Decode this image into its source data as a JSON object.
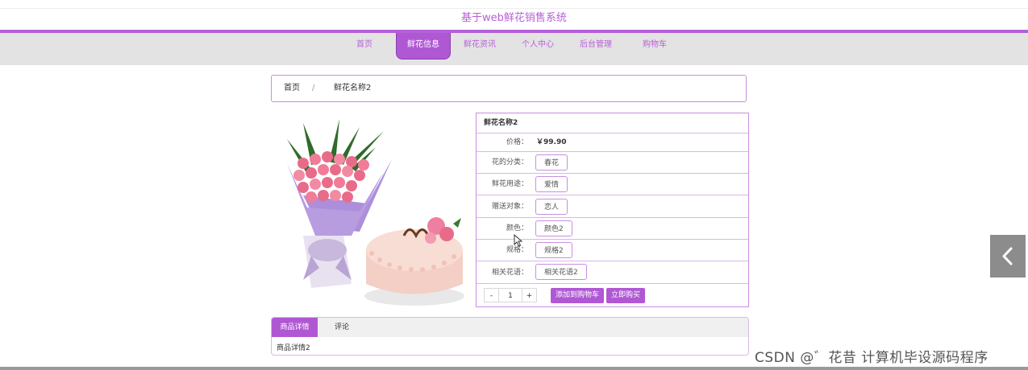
{
  "site": {
    "title": "基于web鲜花销售系统"
  },
  "nav": {
    "items": [
      {
        "label": "首页"
      },
      {
        "label": "鲜花信息"
      },
      {
        "label": "鲜花资讯"
      },
      {
        "label": "个人中心"
      },
      {
        "label": "后台管理"
      },
      {
        "label": "购物车"
      }
    ],
    "active_index": 1
  },
  "breadcrumb": {
    "home": "首页",
    "separator": "/",
    "current": "鲜花名称2"
  },
  "product": {
    "name": "鲜花名称2",
    "price_label": "价格：",
    "price": "￥99.90",
    "fields": [
      {
        "label": "花的分类：",
        "value": "春花"
      },
      {
        "label": "鲜花用途：",
        "value": "爱情"
      },
      {
        "label": "赠送对象：",
        "value": "恋人"
      },
      {
        "label": "颜色：",
        "value": "颜色2"
      },
      {
        "label": "规格：",
        "value": "规格2"
      },
      {
        "label": "相关花语：",
        "value": "相关花语2"
      }
    ],
    "quantity": {
      "minus": "-",
      "value": "1",
      "plus": "+"
    },
    "add_to_cart": "添加到购物车",
    "buy_now": "立即购买"
  },
  "tabs": {
    "items": [
      {
        "label": "商品详情"
      },
      {
        "label": "评论"
      }
    ],
    "active_index": 0,
    "content": "商品详情2"
  },
  "watermark": "CSDN @゛花昔 计算机毕设源码程序",
  "colors": {
    "accent": "#b058d4",
    "nav_bg": "#e3e3e4",
    "border": "#c98ee0"
  },
  "icons": {
    "side_arrow": "chevron-left-icon"
  }
}
